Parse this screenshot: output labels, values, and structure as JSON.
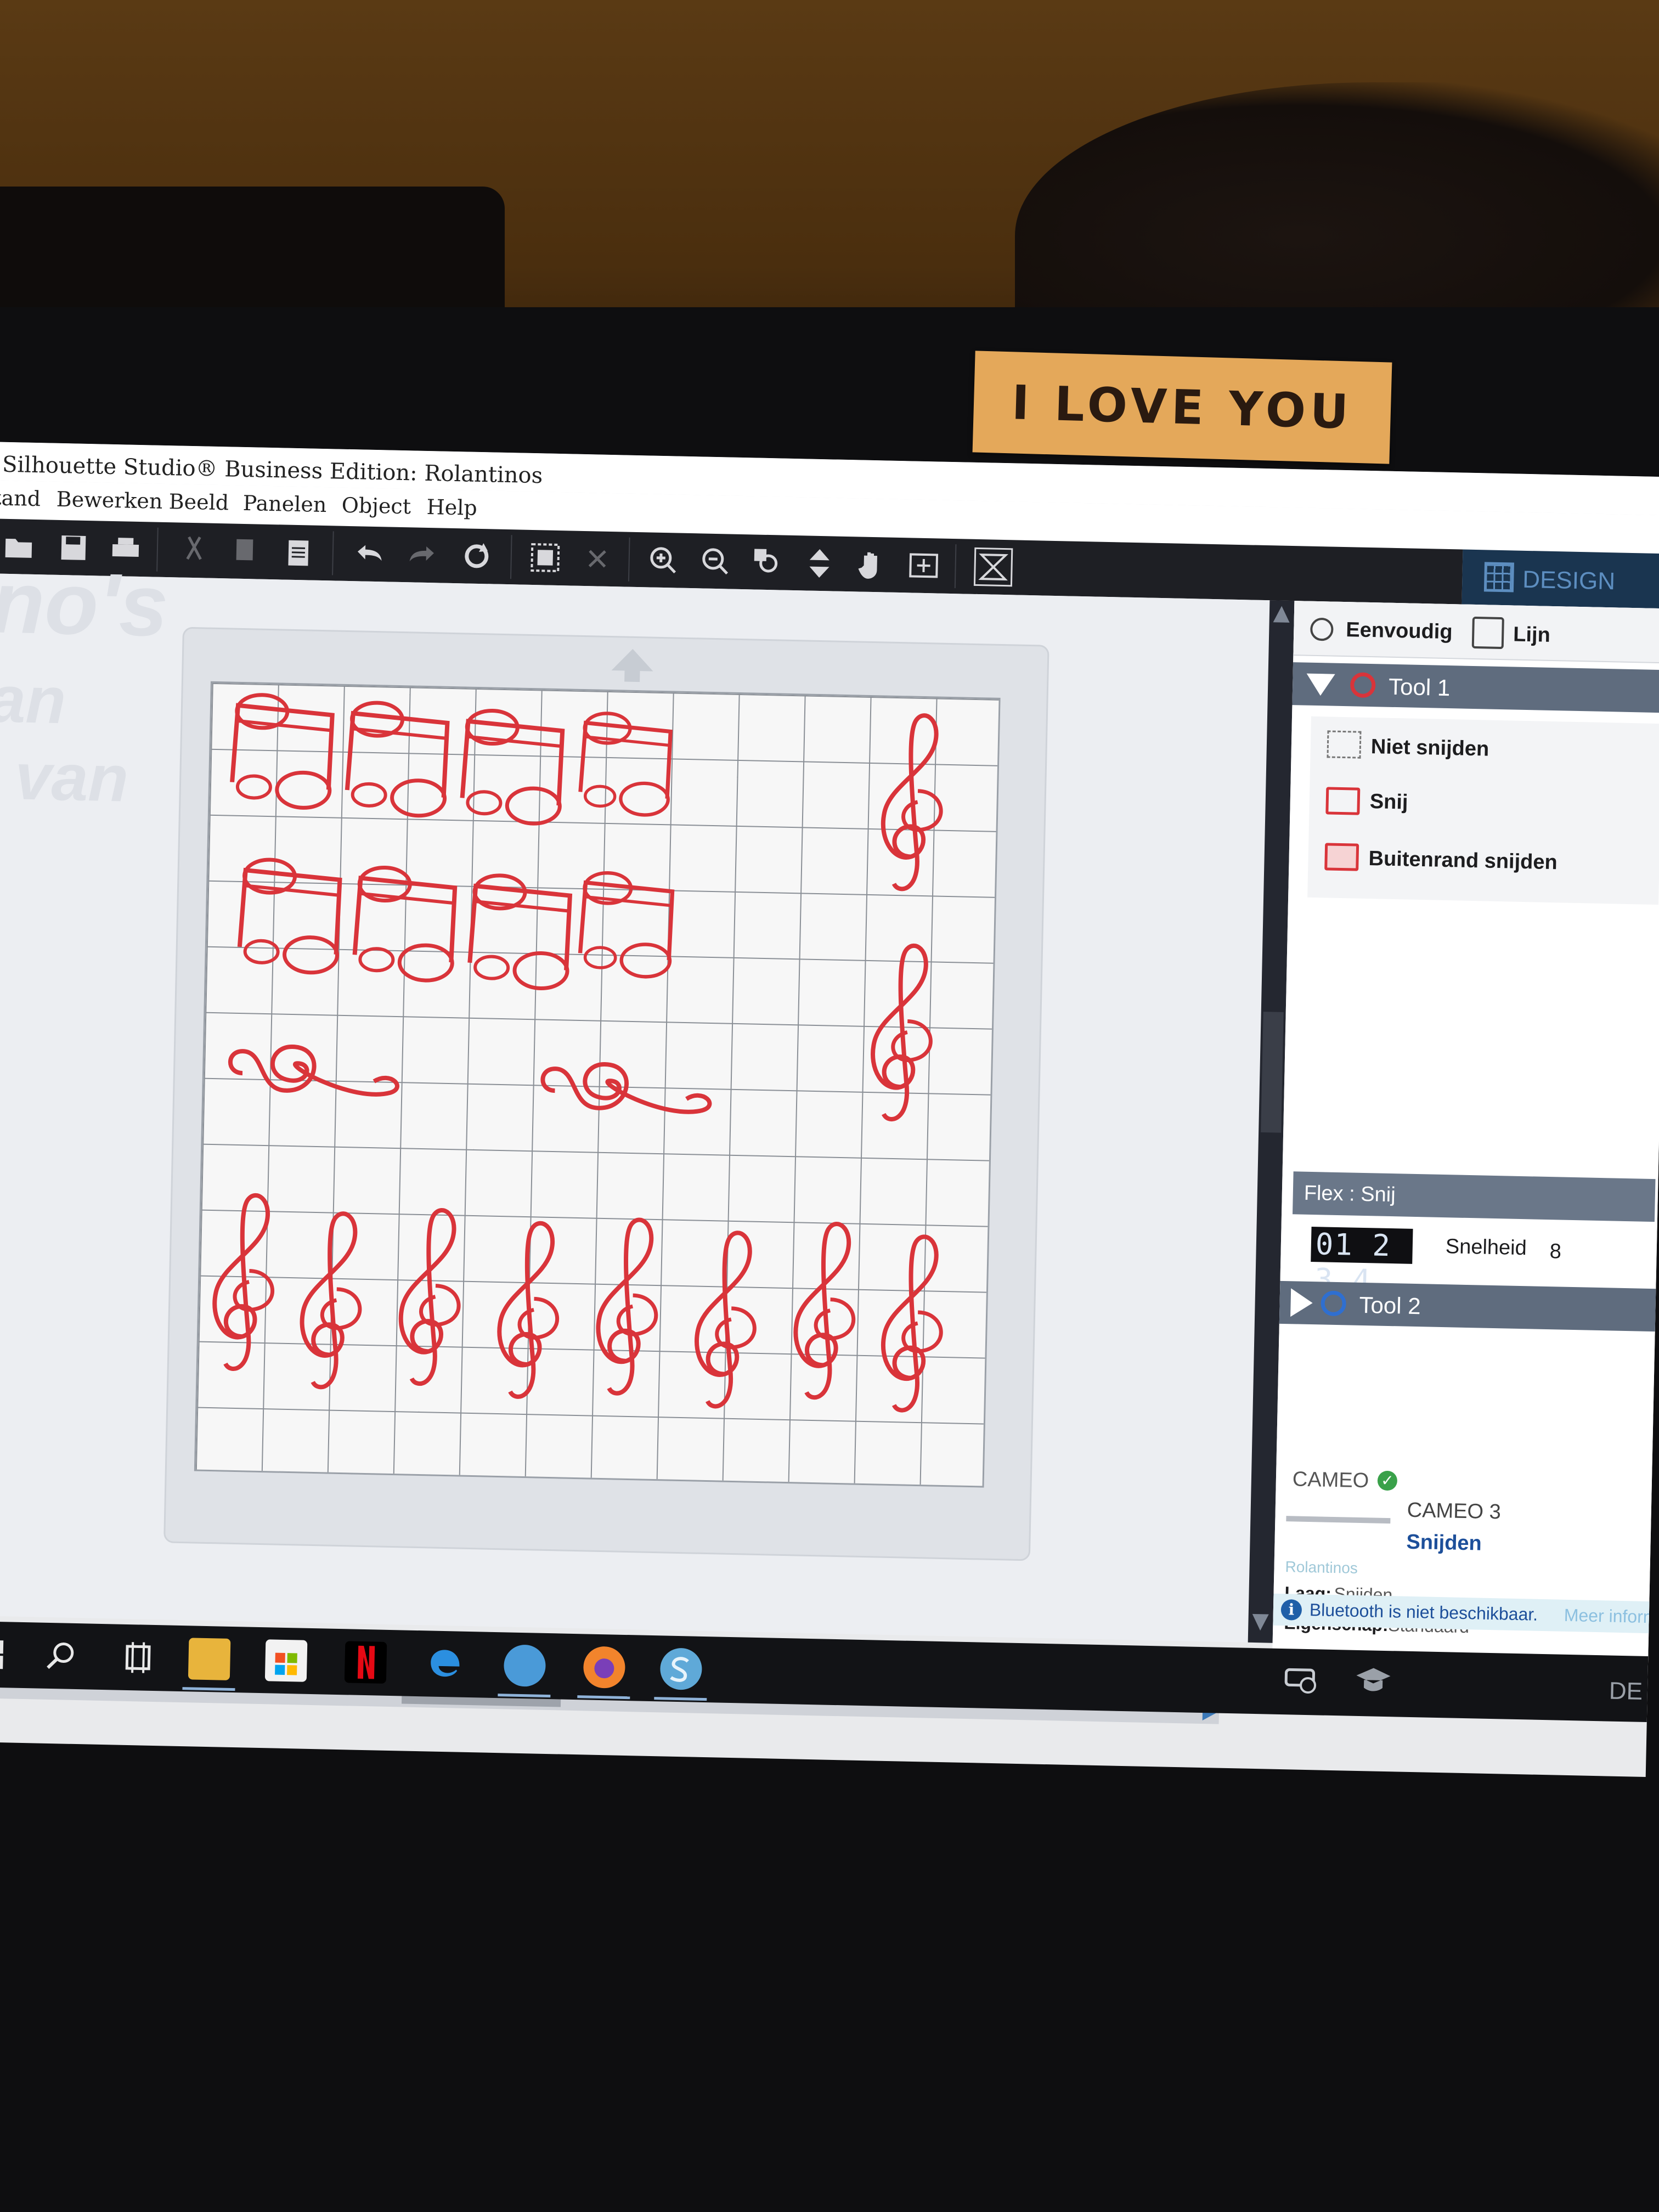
{
  "sticker": {
    "text": "I LOVE YOU"
  },
  "window": {
    "title": "Silhouette Studio® Business Edition: Rolantinos"
  },
  "menu": [
    {
      "label": "stand"
    },
    {
      "label": "Bewerken"
    },
    {
      "label": "Beeld"
    },
    {
      "label": "Panelen"
    },
    {
      "label": "Object"
    },
    {
      "label": "Help"
    }
  ],
  "toolbar": {
    "icons": [
      "open-icon",
      "save-icon",
      "print-icon",
      "cut-icon",
      "copy-icon",
      "paste-icon",
      "undo-icon",
      "redo-icon",
      "refresh-icon",
      "select-all-icon",
      "deselect-icon",
      "zoom-in-icon",
      "zoom-out-icon",
      "zoom-fit-icon",
      "move-down-icon",
      "pan-hand-icon",
      "fit-page-icon",
      "nest-icon"
    ]
  },
  "design_tab": {
    "label": "DESIGN"
  },
  "ghost_text": [
    "no's",
    "an",
    "van"
  ],
  "mat": {
    "shapes": [
      "eighth-note-pair",
      "eighth-note-pair",
      "eighth-note-pair",
      "eighth-note-pair",
      "eighth-note-pair",
      "eighth-note-pair",
      "treble-clef",
      "treble-clef-horizontal",
      "treble-clef-horizontal"
    ],
    "cut_color": "#d9343a"
  },
  "panel": {
    "mode_simple": "Eenvoudig",
    "mode_line": "Lijn",
    "tool1": {
      "label": "Tool 1",
      "color": "#d9343a"
    },
    "options": {
      "no_cut": "Niet snijden",
      "cut": "Snij",
      "cut_edge": "Buitenrand snijden"
    },
    "flex": {
      "label": "Flex : Snij"
    },
    "blade_depth": "01 2 3 4",
    "speed_label": "Snelheid",
    "speed_value": "8",
    "tool2": {
      "label": "Tool 2",
      "color": "#2f6fd0"
    },
    "device": {
      "cameo_label": "CAMEO",
      "model": "CAMEO 3",
      "action": "Snijden",
      "doc_name": "Rolantinos",
      "layer": "Laag:",
      "layer_value": "Snijden",
      "property": "Eigenschap:",
      "property_value": "Standaard"
    },
    "bluetooth": {
      "text": "Bluetooth is niet beschikbaar.",
      "link": "Meer inform"
    },
    "bottom_label": "DE"
  },
  "taskbar": {
    "apps": [
      "start-icon",
      "search-icon",
      "task-view-icon",
      "file-explorer-icon",
      "store-icon",
      "netflix-icon",
      "edge-icon",
      "mail-icon",
      "firefox-icon",
      "silhouette-icon"
    ]
  }
}
